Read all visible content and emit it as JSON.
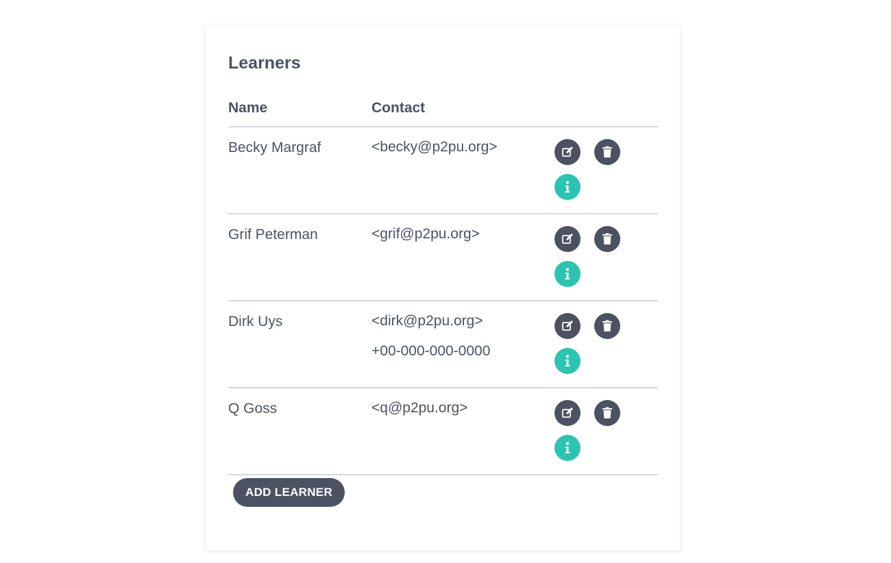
{
  "card": {
    "title": "Learners"
  },
  "table": {
    "headers": {
      "name": "Name",
      "contact": "Contact"
    },
    "rows": [
      {
        "name": "Becky Margraf",
        "email": "<becky@p2pu.org>",
        "phone": ""
      },
      {
        "name": "Grif Peterman",
        "email": "<grif@p2pu.org>",
        "phone": ""
      },
      {
        "name": "Dirk Uys",
        "email": "<dirk@p2pu.org>",
        "phone": "+00-000-000-0000"
      },
      {
        "name": "Q Goss",
        "email": "<q@p2pu.org>",
        "phone": ""
      }
    ]
  },
  "actions": {
    "add_label": "ADD LEARNER",
    "edit_icon": "edit-icon",
    "delete_icon": "trash-icon",
    "info_icon": "info-icon"
  },
  "colors": {
    "text": "#4c5262",
    "button_dark": "#4c5262",
    "info_teal": "#2bc4b0",
    "divider": "#d5d7db"
  }
}
